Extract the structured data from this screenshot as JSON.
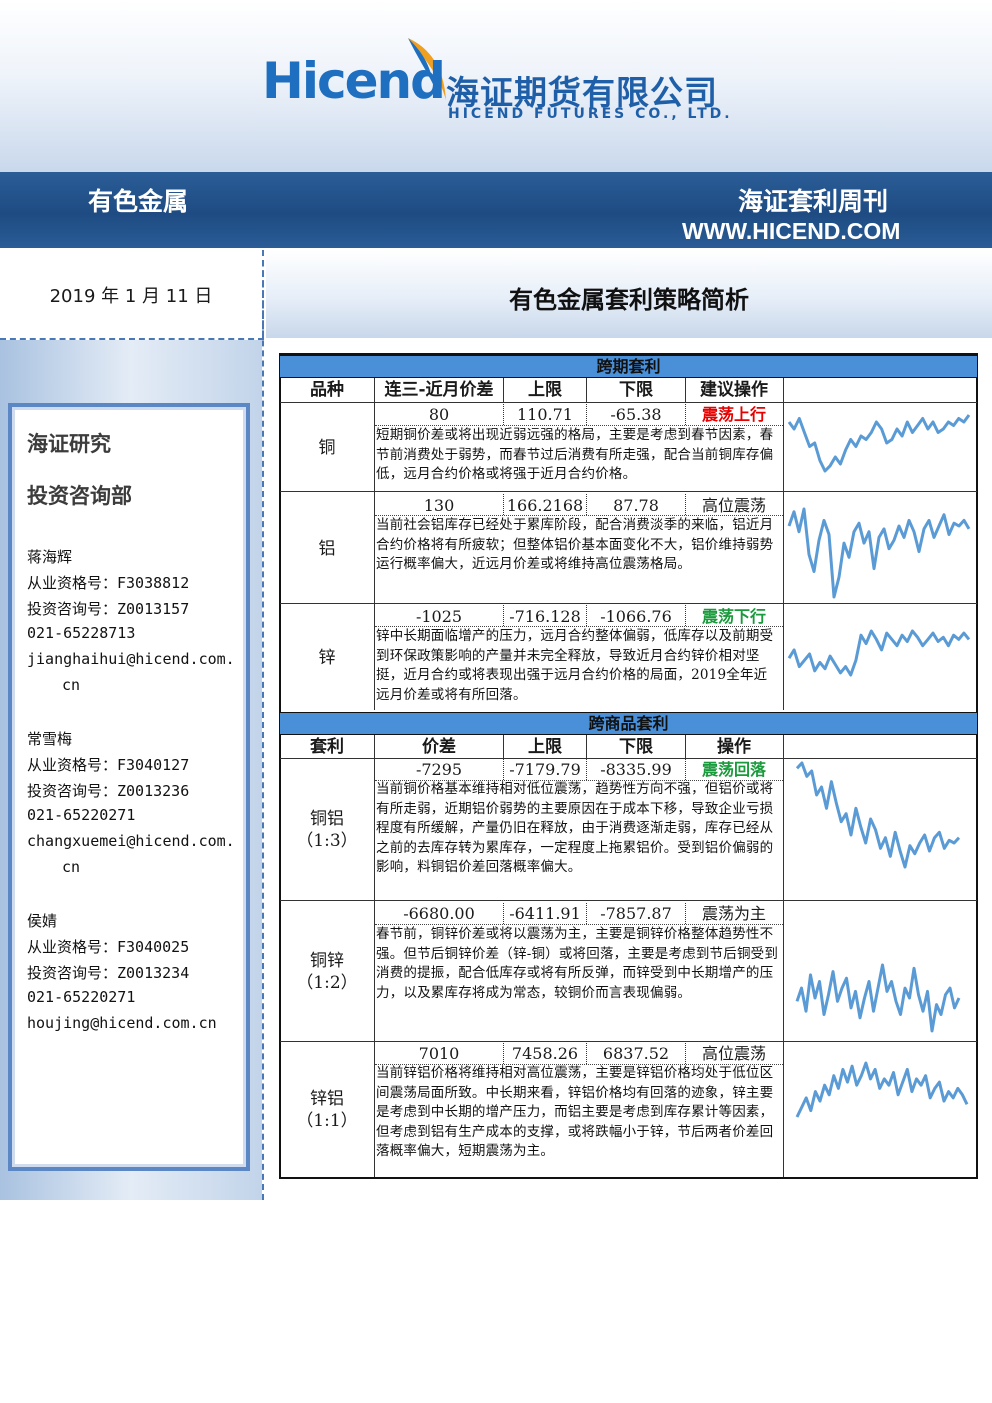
{
  "header": {
    "logo_en": "Hicend",
    "logo_cn": "海证期货有限公司",
    "logo_en_sub": "HICEND  FUTURES  CO.,  LTD.",
    "category": "有色金属",
    "publication": "海证套利周刊",
    "website": "WWW.HICEND.COM"
  },
  "date": "2019 年 1 月 11 日",
  "title": "有色金属套利策略简析",
  "sidebar": {
    "dept_line1": "海证研究",
    "dept_line2": "投资咨询部",
    "analysts": [
      {
        "name": "蒋海辉",
        "qual": "从业资格号：F3038812",
        "consult": "投资咨询号：Z0013157",
        "phone": "021-65228713",
        "email1": "jianghaihui@hicend.com.",
        "email2": "cn"
      },
      {
        "name": "常雪梅",
        "qual": "从业资格号：F3040127",
        "consult": "投资咨询号：Z0013236",
        "phone": "021-65220271",
        "email1": "changxuemei@hicend.com.",
        "email2": "cn"
      },
      {
        "name": "侯婧",
        "qual": "从业资格号：F3040025",
        "consult": "投资咨询号：Z0013234",
        "phone": "021-65220271",
        "email1": "houjing@hicend.com.cn"
      }
    ]
  },
  "intertemporal": {
    "section_title": "跨期套利",
    "headers": [
      "品种",
      "连三-近月价差",
      "上限",
      "下限",
      "建议操作"
    ],
    "rows": [
      {
        "name": "铜",
        "spread": "80",
        "upper": "110.71",
        "lower": "-65.38",
        "action": "震荡上行",
        "action_color": "#e60000",
        "text": "短期铜价差或将出现近弱远强的格局，主要是考虑到春节因素，春节前消费处于弱势，而春节过后消费有所走强，配合当前铜库存偏低，远月合约价格或将强于近月合约价格。"
      },
      {
        "name": "铝",
        "spread": "130",
        "upper": "166.2168",
        "lower": "87.78",
        "action": "高位震荡",
        "action_color": "#111111",
        "text": "当前社会铝库存已经处于累库阶段，配合消费淡季的来临，铝近月合约价格将有所疲软；但整体铝价基本面变化不大，铝价维持弱势运行概率偏大，近远月价差或将维持高位震荡格局。"
      },
      {
        "name": "锌",
        "spread": "-1025",
        "upper": "-716.128",
        "lower": "-1066.76",
        "action": "震荡下行",
        "action_color": "#1a9a3c",
        "text": "锌中长期面临增产的压力，远月合约整体偏弱，低库存以及前期受到环保政策影响的产量并未完全释放，导致近月合约锌价相对坚挺，近月合约或将表现出强于远月合约价格的局面，2019全年近远月价差或将有所回落。"
      }
    ]
  },
  "intercommodity": {
    "section_title": "跨商品套利",
    "headers": [
      "套利",
      "价差",
      "上限",
      "下限",
      "操作"
    ],
    "rows": [
      {
        "name": "铜铝",
        "ratio": "（1:3）",
        "spread": "-7295",
        "upper": "-7179.79",
        "lower": "-8335.99",
        "action": "震荡回落",
        "action_color": "#1a9a3c",
        "text": "当前铜价格基本维持相对低位震荡，趋势性方向不强，但铝价或将有所走弱，近期铝价弱势的主要原因在于成本下移，导致企业亏损程度有所缓解，产量仍旧在释放，由于消费逐渐走弱，库存已经从之前的去库存转为累库存，一定程度上拖累铝价。受到铝价偏弱的影响，料铜铝价差回落概率偏大。"
      },
      {
        "name": "铜锌",
        "ratio": "（1:2）",
        "spread": "-6680.00",
        "upper": "-6411.91",
        "lower": "-7857.87",
        "action": "震荡为主",
        "action_color": "#111111",
        "text": "春节前，铜锌价差或将以震荡为主，主要是铜锌价格整体趋势性不强。但节后铜锌价差（锌-铜）或将回落，主要是考虑到节后铜受到消费的提振，配合低库存或将有所反弹，而锌受到中长期增产的压力，以及累库存将成为常态，较铜价而言表现偏弱。"
      },
      {
        "name": "锌铝",
        "ratio": "（1:1）",
        "spread": "7010",
        "upper": "7458.26",
        "lower": "6837.52",
        "action": "高位震荡",
        "action_color": "#111111",
        "text": "当前锌铝价格将维持相对高位震荡，主要是锌铝价格均处于低位区间震荡局面所致。中长期来看，锌铝价格均有回落的迹象，锌主要是考虑到中长期的增产压力，而铝主要是考虑到库存累计等因素，但考虑到铝有生产成本的支撑，或将跌幅小于锌，节后两者价差回落概率偏大，短期震荡为主。"
      }
    ]
  },
  "sparkline_series": {
    "copper": [
      30,
      34,
      28,
      36,
      44,
      42,
      52,
      58,
      55,
      50,
      54,
      46,
      40,
      44,
      38,
      40,
      36,
      30,
      34,
      42,
      40,
      34,
      38,
      30,
      36,
      32,
      28,
      34,
      30,
      36,
      34,
      30,
      32,
      28,
      30,
      26
    ],
    "aluminum": [
      40,
      30,
      44,
      28,
      60,
      72,
      50,
      36,
      46,
      90,
      76,
      52,
      62,
      44,
      38,
      52,
      44,
      70,
      48,
      42,
      56,
      50,
      40,
      48,
      36,
      44,
      58,
      42,
      36,
      48,
      40,
      32,
      46,
      38,
      40,
      36,
      42
    ],
    "zinc": [
      48,
      40,
      56,
      50,
      44,
      60,
      52,
      58,
      46,
      54,
      62,
      56,
      64,
      50,
      26,
      34,
      22,
      30,
      40,
      24,
      30,
      36,
      26,
      32,
      22,
      28,
      36,
      30,
      24,
      32,
      28,
      36,
      26,
      30,
      24,
      30
    ],
    "cu_al": [
      10,
      6,
      16,
      12,
      30,
      24,
      40,
      20,
      36,
      50,
      44,
      60,
      40,
      54,
      66,
      48,
      56,
      70,
      62,
      76,
      58,
      72,
      84,
      68,
      74,
      66,
      60,
      72,
      62,
      58,
      70,
      64,
      66,
      62
    ],
    "cu_zn": [
      52,
      44,
      58,
      36,
      50,
      40,
      60,
      48,
      34,
      52,
      44,
      38,
      56,
      46,
      62,
      50,
      40,
      58,
      44,
      30,
      46,
      40,
      52,
      60,
      44,
      50,
      32,
      48,
      58,
      46,
      70,
      54,
      60,
      48,
      44,
      56,
      50
    ],
    "zn_al": [
      60,
      54,
      48,
      56,
      44,
      50,
      40,
      46,
      34,
      42,
      30,
      38,
      28,
      40,
      34,
      26,
      36,
      30,
      42,
      36,
      40,
      32,
      46,
      38,
      30,
      44,
      36,
      40,
      34,
      48,
      42,
      38,
      50,
      44,
      48,
      42,
      46,
      52
    ]
  }
}
